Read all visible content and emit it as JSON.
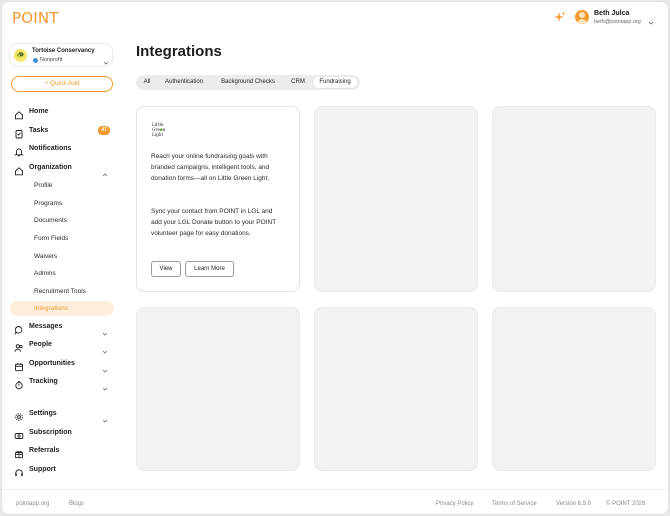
{
  "app": {
    "logo": "POINT"
  },
  "user": {
    "name": "Beth Julca",
    "email": "beth@pointapp.org"
  },
  "org": {
    "name": "Tortoise Conservancy",
    "type": "Nonprofit"
  },
  "quick_add": "Quick Add",
  "nav": {
    "home": "Home",
    "tasks": "Tasks",
    "tasks_count": "47",
    "notifications": "Notifications",
    "organization": "Organization",
    "sub": [
      "Profile",
      "Programs",
      "Documents",
      "Form Fields",
      "Waivers",
      "Admins",
      "Recruitment Tools",
      "Integrations"
    ],
    "messages": "Messages",
    "people": "People",
    "opportunities": "Opportunities",
    "tracking": "Tracking",
    "settings": "Settings",
    "subscription": "Subscription",
    "referrals": "Referrals",
    "support": "Support"
  },
  "page": {
    "title": "Integrations"
  },
  "tabs": [
    "All",
    "Authentication",
    "Background Checks",
    "CRM",
    "Fundraising"
  ],
  "active_tab": "Fundraising",
  "lgl_card": {
    "logo_text": "Little Green Light",
    "description": "Reach your online fundraising goals with branded campaigns, intelligent tools, and donation forms—all on Little Green Light.",
    "description2": "Sync your contact from POINT in LGL and add your LGL Donate button to your POINT volunteer page for easy donations.",
    "view_label": "View",
    "learn_more_label": "Learn More"
  },
  "footer": {
    "site": "pointapp.org",
    "blogs": "Blogs",
    "privacy": "Privacy Policy",
    "terms": "Terms of Service",
    "version": "Version 6.9.0",
    "copyright": "© POINT 2026"
  },
  "colors": {
    "accent": "#f39a2e",
    "active_bg": "#fdeedb",
    "placeholder_card": "#f2f2f3"
  }
}
